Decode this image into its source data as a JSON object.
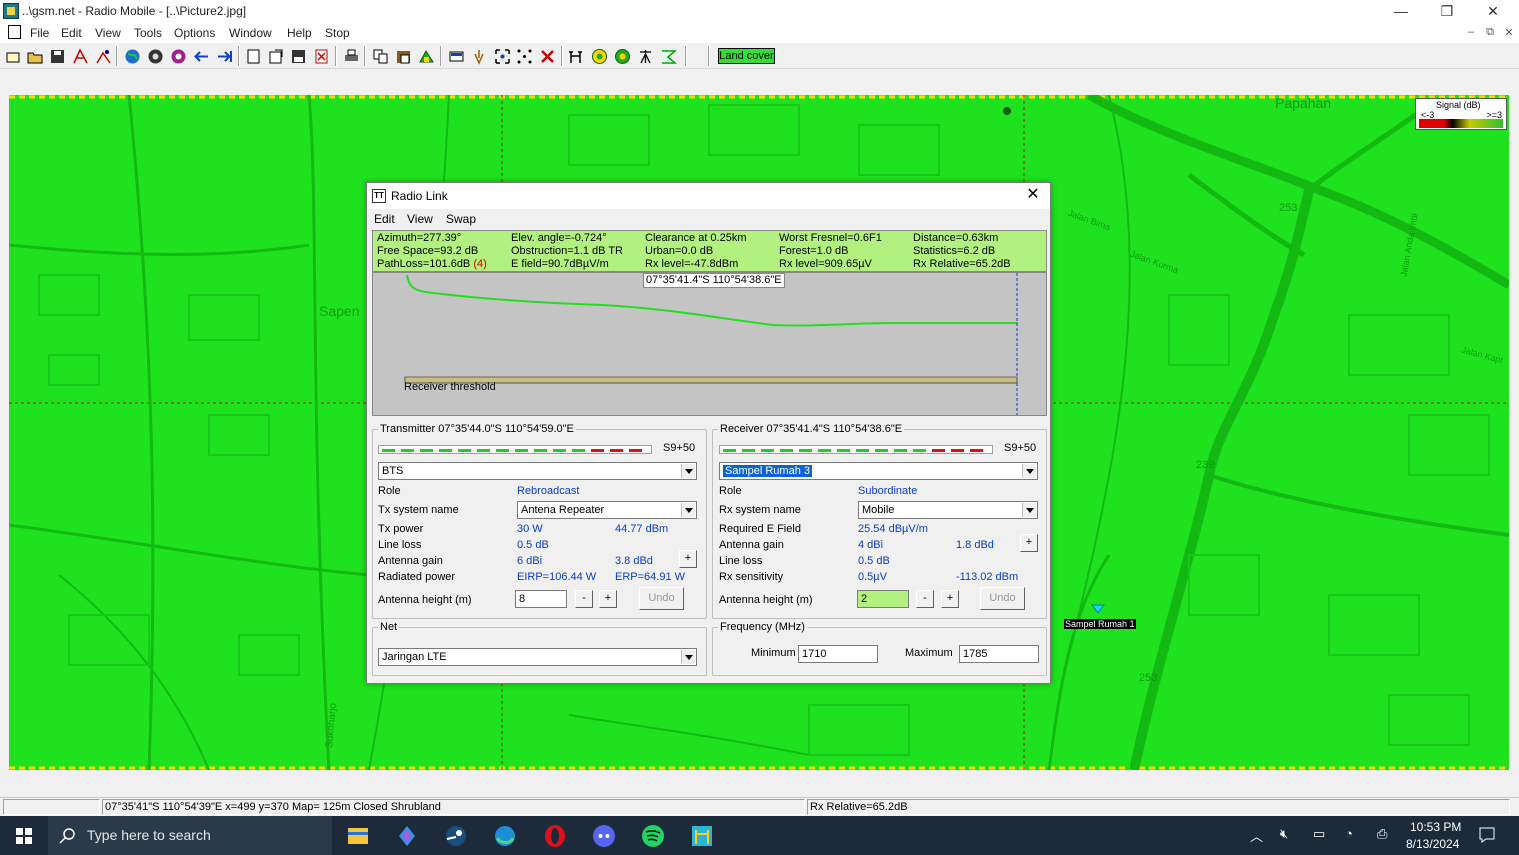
{
  "window": {
    "title": "..\\gsm.net - Radio Mobile - [..\\Picture2.jpg]",
    "minimize": "—",
    "maximize": "❐",
    "close": "✕"
  },
  "menu": [
    "File",
    "Edit",
    "View",
    "Tools",
    "Options",
    "Window",
    "Help",
    "Stop"
  ],
  "toolbar": {
    "land_cover_label": "Land cover",
    "icons": [
      "new-icon",
      "open-icon",
      "save-icon",
      "network-properties-icon",
      "network-units-icon",
      "world-icon",
      "map-properties-icon",
      "map-extract-icon",
      "back-icon",
      "forward-icon",
      "picture-icon",
      "merge-icon",
      "save-picture-icon",
      "delete-picture-icon",
      "print-icon",
      "copy-icon",
      "paste-icon",
      "unit-icon",
      "grid-icon",
      "hand-icon",
      "zoom-icon",
      "points-icon",
      "cross-icon",
      "radio-link-icon",
      "coverage-icon",
      "combined-coverage-icon",
      "antenna-icon",
      "route-icon"
    ]
  },
  "map": {
    "labels": [
      {
        "text": "Papahan"
      },
      {
        "text": "Sapen"
      },
      {
        "text": "Jalan Bima"
      },
      {
        "text": "Jalan Kurma"
      },
      {
        "text": "Jalan Anda Imbi"
      },
      {
        "text": "Jalan Kapt"
      },
      {
        "text": "Sukoharjo"
      },
      {
        "text": "Sampel Rumah 1"
      }
    ],
    "road_numbers": [
      "253",
      "239",
      "253"
    ],
    "legend": {
      "title": "Signal (dB)",
      "low": "<-3",
      "high": ">=3"
    }
  },
  "status_bar": {
    "position": "07°35'41\"S  110°54'39\"E   x=499 y=370 Map= 125m Closed Shrubland",
    "rx_relative": "Rx Relative=65.2dB"
  },
  "taskbar": {
    "search_placeholder": "Type here to search",
    "time": "10:53 PM",
    "date": "8/13/2024",
    "apps": [
      "file-explorer-icon",
      "copilot-icon",
      "steam-icon",
      "edge-icon",
      "opera-icon",
      "discord-icon",
      "spotify-icon",
      "radio-mobile-icon"
    ]
  },
  "dialog": {
    "title": "Radio Link",
    "menu": [
      "Edit",
      "View",
      "Swap"
    ],
    "info": {
      "azimuth": "Azimuth=277.39°",
      "elev": "Elev. angle=-0.724°",
      "clearance": "Clearance at 0.25km",
      "worst_fresnel": "Worst Fresnel=0.6F1",
      "distance": "Distance=0.63km",
      "free_space": "Free Space=93.2 dB",
      "obstruction": "Obstruction=1.1 dB TR",
      "urban": "Urban=0.0 dB",
      "forest": "Forest=1.0 dB",
      "statistics": "Statistics=6.2 dB",
      "path_loss": "PathLoss=101.6dB",
      "path_loss_flag": "(4)",
      "efield": "E field=90.7dBµV/m",
      "rx_level_dbm": "Rx level=-47.8dBm",
      "rx_level_uv": "Rx level=909.65µV",
      "rx_relative": "Rx Relative=65.2dB"
    },
    "profile": {
      "coord": "07°35'41.4\"S 110°54'38.6\"E",
      "receiver_threshold": "Receiver threshold"
    },
    "transmitter": {
      "legend": "Transmitter 07°35'44.0\"S 110°54'59.0\"E",
      "level": "S9+50",
      "unit": "BTS",
      "role_label": "Role",
      "role": "Rebroadcast",
      "system_label": "Tx system name",
      "system": "Antena Repeater",
      "power_label": "Tx power",
      "power_w": "30 W",
      "power_dbm": "44.77 dBm",
      "line_loss_label": "Line loss",
      "line_loss": "0.5 dB",
      "gain_label": "Antenna gain",
      "gain_dbi": "6 dBi",
      "gain_dbd": "3.8 dBd",
      "radiated_label": "Radiated power",
      "eirp": "EIRP=106.44 W",
      "erp": "ERP=64.91 W",
      "height_label": "Antenna height (m)",
      "height": "8",
      "undo": "Undo",
      "minus": "-",
      "plus": "+"
    },
    "receiver": {
      "legend": "Receiver 07°35'41.4\"S 110°54'38.6\"E",
      "level": "S9+50",
      "unit": "Sampel Rumah 3",
      "role_label": "Role",
      "role": "Subordinate",
      "system_label": "Rx system name",
      "system": "Mobile",
      "req_label": "Required E Field",
      "req": "25.54 dBµV/m",
      "gain_label": "Antenna gain",
      "gain_dbi": "4 dBi",
      "gain_dbd": "1.8 dBd",
      "line_loss_label": "Line loss",
      "line_loss": "0.5 dB",
      "sens_label": "Rx sensitivity",
      "sens_uv": "0.5µV",
      "sens_dbm": "-113.02 dBm",
      "height_label": "Antenna height (m)",
      "height": "2",
      "undo": "Undo",
      "minus": "-",
      "plus": "+"
    },
    "net": {
      "legend": "Net",
      "value": "Jaringan LTE"
    },
    "frequency": {
      "legend": "Frequency (MHz)",
      "min_label": "Minimum",
      "min": "1710",
      "max_label": "Maximum",
      "max": "1785"
    },
    "colors": {
      "info_bg": "#b2f07f",
      "profile_bg": "#c4c4c4",
      "profile_line": "#22dd22"
    }
  }
}
